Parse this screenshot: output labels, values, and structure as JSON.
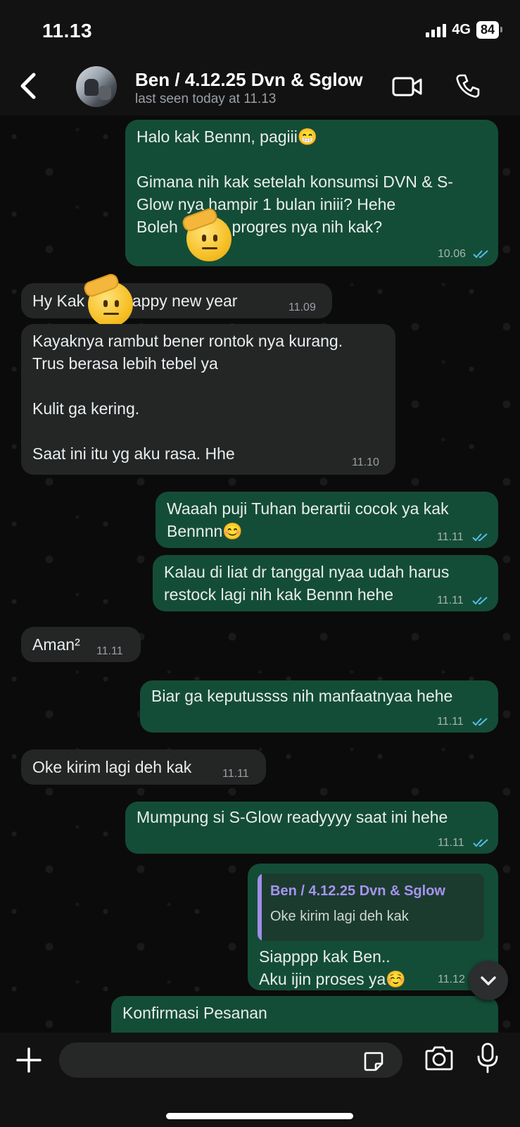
{
  "status_bar": {
    "time": "11.13",
    "network": "4G",
    "battery": "84"
  },
  "header": {
    "title": "Ben / 4.12.25 Dvn & Sglow",
    "subtitle": "last seen today at 11.13"
  },
  "messages": [
    {
      "dir": "out",
      "text": "Halo kak Bennn, pagiii😁\n\nGimana nih kak setelah konsumsi DVN & S-\nGlow nya hampir 1 bulan iniii? Hehe\nBoleh      tau progres nya nih kak?",
      "time": "10.06"
    },
    {
      "dir": "in",
      "text": "Hy Kak      . Happy new year",
      "time": "11.09"
    },
    {
      "dir": "in",
      "text": "Kayaknya rambut bener rontok nya kurang.\nTrus berasa lebih tebel ya\n\nKulit ga kering.\n\nSaat ini itu yg aku rasa. Hhe",
      "time": "11.10"
    },
    {
      "dir": "out",
      "text": "Waaah puji Tuhan berartii cocok ya kak\nBennnn😊",
      "time": "11.11"
    },
    {
      "dir": "out",
      "text": "Kalau di liat dr tanggal nyaa udah harus\nrestock lagi nih kak Bennn hehe",
      "time": "11.11"
    },
    {
      "dir": "in",
      "text": "Aman²",
      "time": "11.11"
    },
    {
      "dir": "out",
      "text": "Biar ga keputussss nih manfaatnyaa hehe",
      "time": "11.11"
    },
    {
      "dir": "in",
      "text": "Oke kirim lagi deh kak",
      "time": "11.11"
    },
    {
      "dir": "out",
      "text": "Mumpung si S-Glow readyyyy saat ini hehe",
      "time": "11.11"
    },
    {
      "dir": "out",
      "reply_to": {
        "name": "Ben / 4.12.25 Dvn & Sglow",
        "text": "Oke kirim lagi deh kak"
      },
      "text": "Siapppp kak Ben..\nAku ijin proses ya☺️",
      "time": "11.12"
    },
    {
      "dir": "out",
      "text": "Konfirmasi Pesanan",
      "time": ""
    }
  ],
  "icons": {
    "back": "chevron-left-icon",
    "video": "video-call-icon",
    "call": "phone-icon",
    "attach": "plus-icon",
    "sticker": "sticker-icon",
    "camera": "camera-icon",
    "mic": "microphone-icon",
    "scroll": "chevron-down-icon"
  },
  "colors": {
    "outgoing_bubble": "#144d37",
    "incoming_bubble": "#242626",
    "read_ticks": "#53bdeb",
    "quote_name": "#a594f0"
  }
}
